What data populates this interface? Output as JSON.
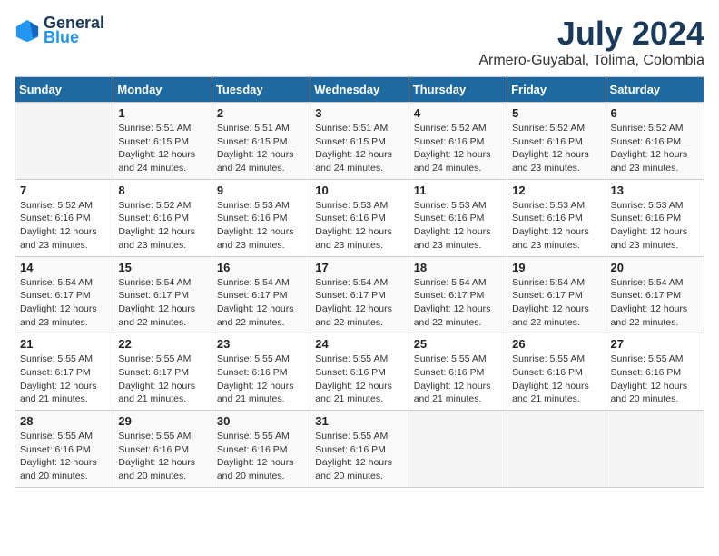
{
  "header": {
    "logo_line1": "General",
    "logo_line2": "Blue",
    "title": "July 2024",
    "subtitle": "Armero-Guyabal, Tolima, Colombia"
  },
  "weekdays": [
    "Sunday",
    "Monday",
    "Tuesday",
    "Wednesday",
    "Thursday",
    "Friday",
    "Saturday"
  ],
  "weeks": [
    [
      {
        "day": "",
        "info": ""
      },
      {
        "day": "1",
        "info": "Sunrise: 5:51 AM\nSunset: 6:15 PM\nDaylight: 12 hours\nand 24 minutes."
      },
      {
        "day": "2",
        "info": "Sunrise: 5:51 AM\nSunset: 6:15 PM\nDaylight: 12 hours\nand 24 minutes."
      },
      {
        "day": "3",
        "info": "Sunrise: 5:51 AM\nSunset: 6:15 PM\nDaylight: 12 hours\nand 24 minutes."
      },
      {
        "day": "4",
        "info": "Sunrise: 5:52 AM\nSunset: 6:16 PM\nDaylight: 12 hours\nand 24 minutes."
      },
      {
        "day": "5",
        "info": "Sunrise: 5:52 AM\nSunset: 6:16 PM\nDaylight: 12 hours\nand 23 minutes."
      },
      {
        "day": "6",
        "info": "Sunrise: 5:52 AM\nSunset: 6:16 PM\nDaylight: 12 hours\nand 23 minutes."
      }
    ],
    [
      {
        "day": "7",
        "info": "Sunrise: 5:52 AM\nSunset: 6:16 PM\nDaylight: 12 hours\nand 23 minutes."
      },
      {
        "day": "8",
        "info": "Sunrise: 5:52 AM\nSunset: 6:16 PM\nDaylight: 12 hours\nand 23 minutes."
      },
      {
        "day": "9",
        "info": "Sunrise: 5:53 AM\nSunset: 6:16 PM\nDaylight: 12 hours\nand 23 minutes."
      },
      {
        "day": "10",
        "info": "Sunrise: 5:53 AM\nSunset: 6:16 PM\nDaylight: 12 hours\nand 23 minutes."
      },
      {
        "day": "11",
        "info": "Sunrise: 5:53 AM\nSunset: 6:16 PM\nDaylight: 12 hours\nand 23 minutes."
      },
      {
        "day": "12",
        "info": "Sunrise: 5:53 AM\nSunset: 6:16 PM\nDaylight: 12 hours\nand 23 minutes."
      },
      {
        "day": "13",
        "info": "Sunrise: 5:53 AM\nSunset: 6:16 PM\nDaylight: 12 hours\nand 23 minutes."
      }
    ],
    [
      {
        "day": "14",
        "info": "Sunrise: 5:54 AM\nSunset: 6:17 PM\nDaylight: 12 hours\nand 23 minutes."
      },
      {
        "day": "15",
        "info": "Sunrise: 5:54 AM\nSunset: 6:17 PM\nDaylight: 12 hours\nand 22 minutes."
      },
      {
        "day": "16",
        "info": "Sunrise: 5:54 AM\nSunset: 6:17 PM\nDaylight: 12 hours\nand 22 minutes."
      },
      {
        "day": "17",
        "info": "Sunrise: 5:54 AM\nSunset: 6:17 PM\nDaylight: 12 hours\nand 22 minutes."
      },
      {
        "day": "18",
        "info": "Sunrise: 5:54 AM\nSunset: 6:17 PM\nDaylight: 12 hours\nand 22 minutes."
      },
      {
        "day": "19",
        "info": "Sunrise: 5:54 AM\nSunset: 6:17 PM\nDaylight: 12 hours\nand 22 minutes."
      },
      {
        "day": "20",
        "info": "Sunrise: 5:54 AM\nSunset: 6:17 PM\nDaylight: 12 hours\nand 22 minutes."
      }
    ],
    [
      {
        "day": "21",
        "info": "Sunrise: 5:55 AM\nSunset: 6:17 PM\nDaylight: 12 hours\nand 21 minutes."
      },
      {
        "day": "22",
        "info": "Sunrise: 5:55 AM\nSunset: 6:17 PM\nDaylight: 12 hours\nand 21 minutes."
      },
      {
        "day": "23",
        "info": "Sunrise: 5:55 AM\nSunset: 6:16 PM\nDaylight: 12 hours\nand 21 minutes."
      },
      {
        "day": "24",
        "info": "Sunrise: 5:55 AM\nSunset: 6:16 PM\nDaylight: 12 hours\nand 21 minutes."
      },
      {
        "day": "25",
        "info": "Sunrise: 5:55 AM\nSunset: 6:16 PM\nDaylight: 12 hours\nand 21 minutes."
      },
      {
        "day": "26",
        "info": "Sunrise: 5:55 AM\nSunset: 6:16 PM\nDaylight: 12 hours\nand 21 minutes."
      },
      {
        "day": "27",
        "info": "Sunrise: 5:55 AM\nSunset: 6:16 PM\nDaylight: 12 hours\nand 20 minutes."
      }
    ],
    [
      {
        "day": "28",
        "info": "Sunrise: 5:55 AM\nSunset: 6:16 PM\nDaylight: 12 hours\nand 20 minutes."
      },
      {
        "day": "29",
        "info": "Sunrise: 5:55 AM\nSunset: 6:16 PM\nDaylight: 12 hours\nand 20 minutes."
      },
      {
        "day": "30",
        "info": "Sunrise: 5:55 AM\nSunset: 6:16 PM\nDaylight: 12 hours\nand 20 minutes."
      },
      {
        "day": "31",
        "info": "Sunrise: 5:55 AM\nSunset: 6:16 PM\nDaylight: 12 hours\nand 20 minutes."
      },
      {
        "day": "",
        "info": ""
      },
      {
        "day": "",
        "info": ""
      },
      {
        "day": "",
        "info": ""
      }
    ]
  ]
}
